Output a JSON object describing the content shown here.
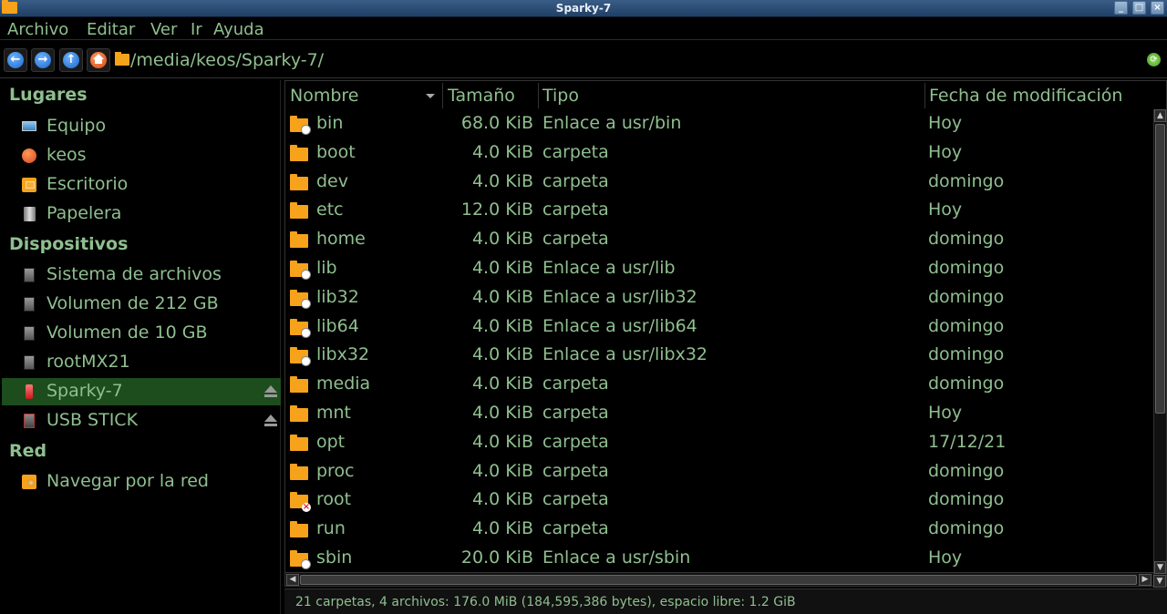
{
  "window": {
    "title": "Sparky-7"
  },
  "menu": [
    "Archivo",
    "Editar",
    "Ver",
    "Ir",
    "Ayuda"
  ],
  "location": {
    "path": "/media/keos/Sparky-7/"
  },
  "sidebar": {
    "places_header": "Lugares",
    "places": [
      "Equipo",
      "keos",
      "Escritorio",
      "Papelera"
    ],
    "devices_header": "Dispositivos",
    "devices": [
      "Sistema de archivos",
      "Volumen de 212 GB",
      "Volumen de 10 GB",
      "rootMX21",
      "Sparky-7",
      "USB STICK"
    ],
    "network_header": "Red",
    "network": [
      "Navegar por la red"
    ]
  },
  "columns": {
    "name": "Nombre",
    "size": "Tamaño",
    "type": "Tipo",
    "date": "Fecha de modificación"
  },
  "files": [
    {
      "name": "bin",
      "size": "68.0 KiB",
      "type": "Enlace a usr/bin",
      "date": "Hoy"
    },
    {
      "name": "boot",
      "size": "4.0 KiB",
      "type": "carpeta",
      "date": "Hoy"
    },
    {
      "name": "dev",
      "size": "4.0 KiB",
      "type": "carpeta",
      "date": "domingo"
    },
    {
      "name": "etc",
      "size": "12.0 KiB",
      "type": "carpeta",
      "date": "Hoy"
    },
    {
      "name": "home",
      "size": "4.0 KiB",
      "type": "carpeta",
      "date": "domingo"
    },
    {
      "name": "lib",
      "size": "4.0 KiB",
      "type": "Enlace a usr/lib",
      "date": "domingo"
    },
    {
      "name": "lib32",
      "size": "4.0 KiB",
      "type": "Enlace a usr/lib32",
      "date": "domingo"
    },
    {
      "name": "lib64",
      "size": "4.0 KiB",
      "type": "Enlace a usr/lib64",
      "date": "domingo"
    },
    {
      "name": "libx32",
      "size": "4.0 KiB",
      "type": "Enlace a usr/libx32",
      "date": "domingo"
    },
    {
      "name": "media",
      "size": "4.0 KiB",
      "type": "carpeta",
      "date": "domingo"
    },
    {
      "name": "mnt",
      "size": "4.0 KiB",
      "type": "carpeta",
      "date": "Hoy"
    },
    {
      "name": "opt",
      "size": "4.0 KiB",
      "type": "carpeta",
      "date": "17/12/21"
    },
    {
      "name": "proc",
      "size": "4.0 KiB",
      "type": "carpeta",
      "date": "domingo"
    },
    {
      "name": "root",
      "size": "4.0 KiB",
      "type": "carpeta",
      "date": "domingo"
    },
    {
      "name": "run",
      "size": "4.0 KiB",
      "type": "carpeta",
      "date": "domingo"
    },
    {
      "name": "sbin",
      "size": "20.0 KiB",
      "type": "Enlace a usr/sbin",
      "date": "Hoy"
    }
  ],
  "status": {
    "text": "21 carpetas, 4 archivos: 176.0 MiB (184,595,386 bytes), espacio libre: 1.2 GiB"
  }
}
